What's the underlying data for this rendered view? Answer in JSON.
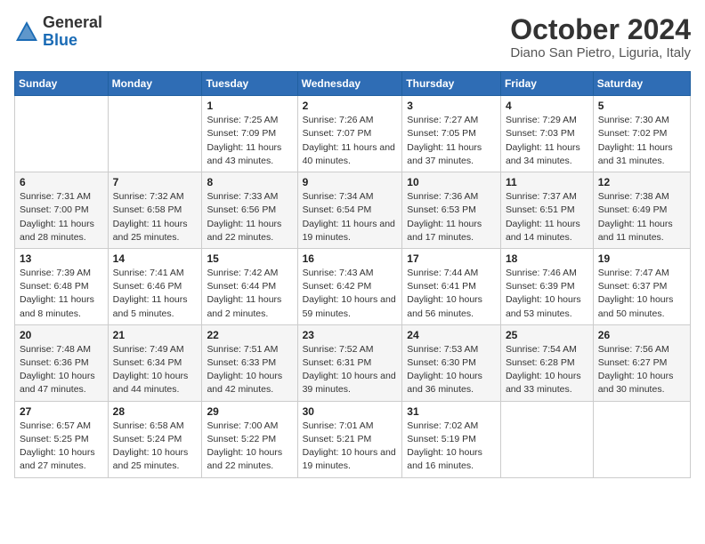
{
  "header": {
    "logo_general": "General",
    "logo_blue": "Blue",
    "month_year": "October 2024",
    "location": "Diano San Pietro, Liguria, Italy"
  },
  "days_of_week": [
    "Sunday",
    "Monday",
    "Tuesday",
    "Wednesday",
    "Thursday",
    "Friday",
    "Saturday"
  ],
  "weeks": [
    [
      {
        "day": "",
        "info": ""
      },
      {
        "day": "",
        "info": ""
      },
      {
        "day": "1",
        "info": "Sunrise: 7:25 AM\nSunset: 7:09 PM\nDaylight: 11 hours and 43 minutes."
      },
      {
        "day": "2",
        "info": "Sunrise: 7:26 AM\nSunset: 7:07 PM\nDaylight: 11 hours and 40 minutes."
      },
      {
        "day": "3",
        "info": "Sunrise: 7:27 AM\nSunset: 7:05 PM\nDaylight: 11 hours and 37 minutes."
      },
      {
        "day": "4",
        "info": "Sunrise: 7:29 AM\nSunset: 7:03 PM\nDaylight: 11 hours and 34 minutes."
      },
      {
        "day": "5",
        "info": "Sunrise: 7:30 AM\nSunset: 7:02 PM\nDaylight: 11 hours and 31 minutes."
      }
    ],
    [
      {
        "day": "6",
        "info": "Sunrise: 7:31 AM\nSunset: 7:00 PM\nDaylight: 11 hours and 28 minutes."
      },
      {
        "day": "7",
        "info": "Sunrise: 7:32 AM\nSunset: 6:58 PM\nDaylight: 11 hours and 25 minutes."
      },
      {
        "day": "8",
        "info": "Sunrise: 7:33 AM\nSunset: 6:56 PM\nDaylight: 11 hours and 22 minutes."
      },
      {
        "day": "9",
        "info": "Sunrise: 7:34 AM\nSunset: 6:54 PM\nDaylight: 11 hours and 19 minutes."
      },
      {
        "day": "10",
        "info": "Sunrise: 7:36 AM\nSunset: 6:53 PM\nDaylight: 11 hours and 17 minutes."
      },
      {
        "day": "11",
        "info": "Sunrise: 7:37 AM\nSunset: 6:51 PM\nDaylight: 11 hours and 14 minutes."
      },
      {
        "day": "12",
        "info": "Sunrise: 7:38 AM\nSunset: 6:49 PM\nDaylight: 11 hours and 11 minutes."
      }
    ],
    [
      {
        "day": "13",
        "info": "Sunrise: 7:39 AM\nSunset: 6:48 PM\nDaylight: 11 hours and 8 minutes."
      },
      {
        "day": "14",
        "info": "Sunrise: 7:41 AM\nSunset: 6:46 PM\nDaylight: 11 hours and 5 minutes."
      },
      {
        "day": "15",
        "info": "Sunrise: 7:42 AM\nSunset: 6:44 PM\nDaylight: 11 hours and 2 minutes."
      },
      {
        "day": "16",
        "info": "Sunrise: 7:43 AM\nSunset: 6:42 PM\nDaylight: 10 hours and 59 minutes."
      },
      {
        "day": "17",
        "info": "Sunrise: 7:44 AM\nSunset: 6:41 PM\nDaylight: 10 hours and 56 minutes."
      },
      {
        "day": "18",
        "info": "Sunrise: 7:46 AM\nSunset: 6:39 PM\nDaylight: 10 hours and 53 minutes."
      },
      {
        "day": "19",
        "info": "Sunrise: 7:47 AM\nSunset: 6:37 PM\nDaylight: 10 hours and 50 minutes."
      }
    ],
    [
      {
        "day": "20",
        "info": "Sunrise: 7:48 AM\nSunset: 6:36 PM\nDaylight: 10 hours and 47 minutes."
      },
      {
        "day": "21",
        "info": "Sunrise: 7:49 AM\nSunset: 6:34 PM\nDaylight: 10 hours and 44 minutes."
      },
      {
        "day": "22",
        "info": "Sunrise: 7:51 AM\nSunset: 6:33 PM\nDaylight: 10 hours and 42 minutes."
      },
      {
        "day": "23",
        "info": "Sunrise: 7:52 AM\nSunset: 6:31 PM\nDaylight: 10 hours and 39 minutes."
      },
      {
        "day": "24",
        "info": "Sunrise: 7:53 AM\nSunset: 6:30 PM\nDaylight: 10 hours and 36 minutes."
      },
      {
        "day": "25",
        "info": "Sunrise: 7:54 AM\nSunset: 6:28 PM\nDaylight: 10 hours and 33 minutes."
      },
      {
        "day": "26",
        "info": "Sunrise: 7:56 AM\nSunset: 6:27 PM\nDaylight: 10 hours and 30 minutes."
      }
    ],
    [
      {
        "day": "27",
        "info": "Sunrise: 6:57 AM\nSunset: 5:25 PM\nDaylight: 10 hours and 27 minutes."
      },
      {
        "day": "28",
        "info": "Sunrise: 6:58 AM\nSunset: 5:24 PM\nDaylight: 10 hours and 25 minutes."
      },
      {
        "day": "29",
        "info": "Sunrise: 7:00 AM\nSunset: 5:22 PM\nDaylight: 10 hours and 22 minutes."
      },
      {
        "day": "30",
        "info": "Sunrise: 7:01 AM\nSunset: 5:21 PM\nDaylight: 10 hours and 19 minutes."
      },
      {
        "day": "31",
        "info": "Sunrise: 7:02 AM\nSunset: 5:19 PM\nDaylight: 10 hours and 16 minutes."
      },
      {
        "day": "",
        "info": ""
      },
      {
        "day": "",
        "info": ""
      }
    ]
  ]
}
